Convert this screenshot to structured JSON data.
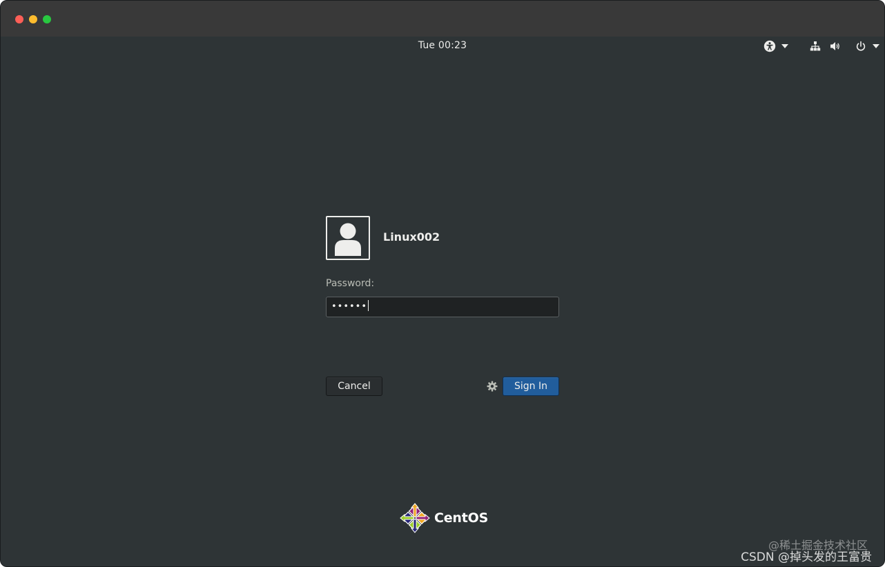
{
  "window": {
    "controls": [
      "close",
      "minimize",
      "maximize"
    ]
  },
  "top_bar": {
    "clock": "Tue 00:23",
    "icons": [
      "accessibility-icon",
      "network-icon",
      "volume-icon",
      "power-icon"
    ]
  },
  "login": {
    "username": "Linux002",
    "password_label": "Password:",
    "password_value": "••••••",
    "cancel_label": "Cancel",
    "signin_label": "Sign In"
  },
  "branding": {
    "name": "CentOS"
  },
  "watermark": {
    "line1": "@稀土掘金技术社区",
    "line2": "CSDN @掉头发的王富贵"
  },
  "colors": {
    "background": "#2e3436",
    "accent": "#215d9c"
  }
}
